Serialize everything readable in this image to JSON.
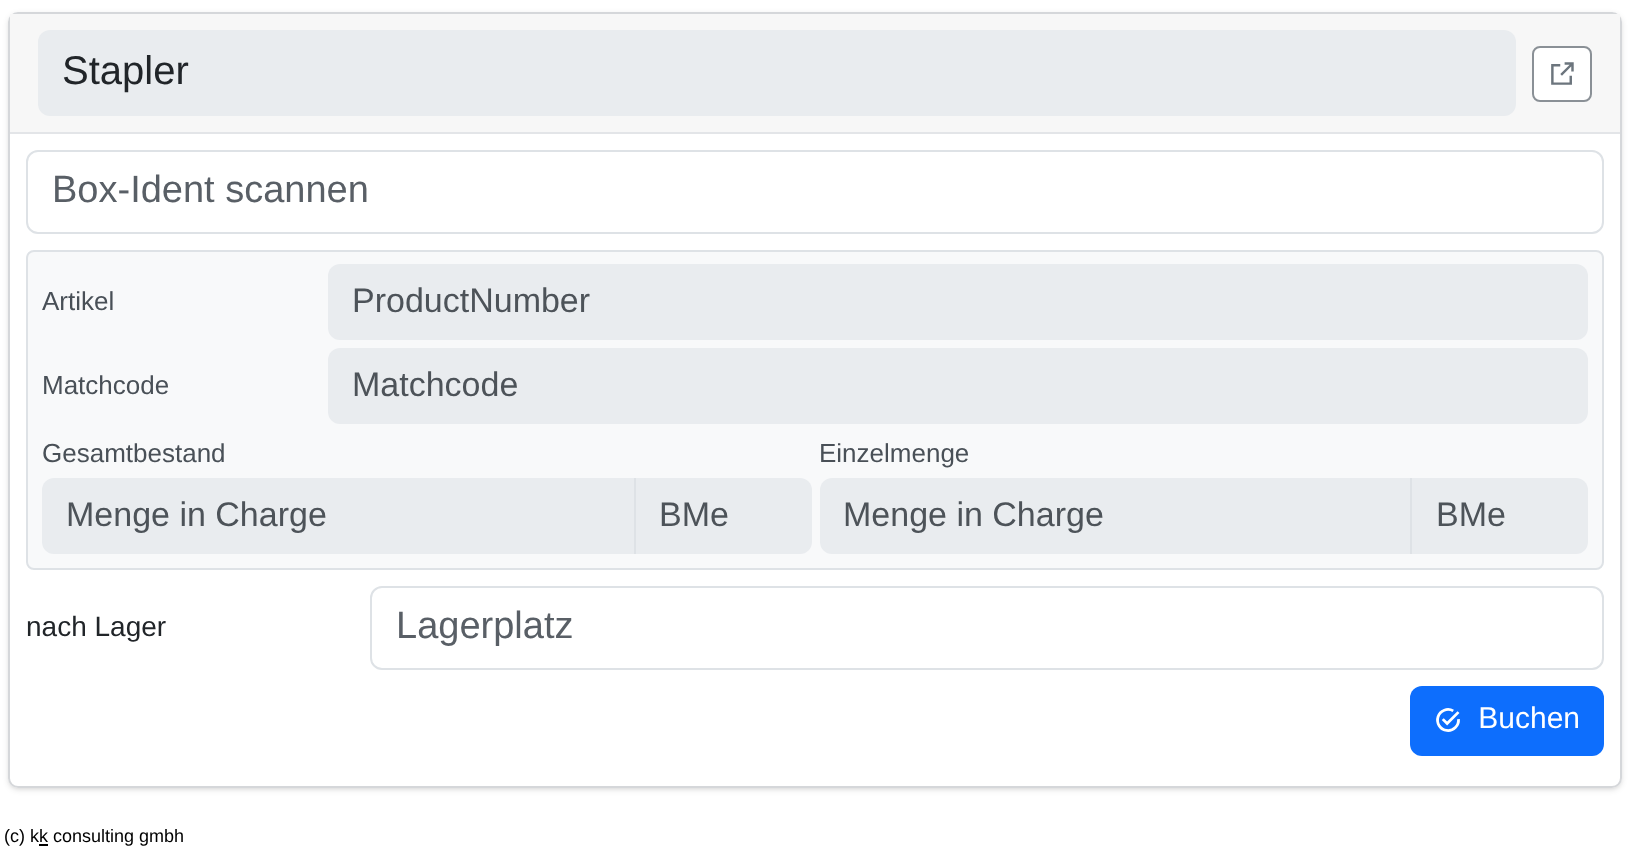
{
  "header": {
    "value": "Stapler",
    "disabled": true
  },
  "scan_field": {
    "placeholder": "Box-Ident scannen"
  },
  "details": {
    "rows": [
      {
        "label": "Artikel",
        "placeholder": "ProductNumber",
        "disabled": true
      },
      {
        "label": "Matchcode",
        "placeholder": "Matchcode",
        "disabled": true
      }
    ],
    "groups": [
      {
        "label": "Gesamtbestand",
        "placeholder": "Menge in Charge",
        "unit": "BMe",
        "disabled": true
      },
      {
        "label": "Einzelmenge",
        "placeholder": "Menge in Charge",
        "unit": "BMe",
        "disabled": true
      }
    ]
  },
  "target": {
    "label": "nach Lager",
    "placeholder": "Lagerplatz"
  },
  "submit": {
    "label": "Buchen"
  },
  "footer": {
    "before": "(c) k",
    "underlined": "k",
    "after": " consulting gmbh"
  }
}
